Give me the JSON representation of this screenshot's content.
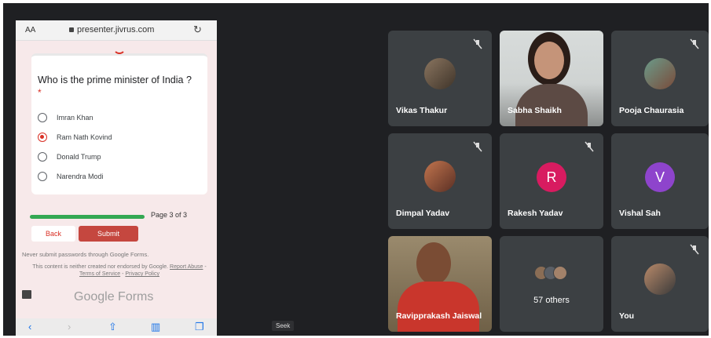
{
  "browser": {
    "text_size_label": "AA",
    "url": "presenter.jivrus.com"
  },
  "form": {
    "question": "Who is the prime minister of India ?",
    "required_mark": "*",
    "options": [
      {
        "label": "Imran Khan",
        "selected": false
      },
      {
        "label": "Ram Nath Kovind",
        "selected": true
      },
      {
        "label": "Donald Trump",
        "selected": false
      },
      {
        "label": "Narendra Modi",
        "selected": false
      }
    ],
    "progress": 1.0,
    "page_label": "Page 3 of 3",
    "back_label": "Back",
    "submit_label": "Submit",
    "password_note": "Never submit passwords through Google Forms.",
    "disclaimer_start": "This content is neither created nor endorsed by Google.",
    "report_abuse": "Report Abuse",
    "terms": "Terms of Service",
    "privacy": "Privacy Policy",
    "brand": "Google Forms"
  },
  "seek_label": "Seek",
  "participants": [
    {
      "name": "Vikas Thakur"
    },
    {
      "name": "Sabha Shaikh"
    },
    {
      "name": "Pooja Chaurasia"
    },
    {
      "name": "Dimpal Yadav"
    },
    {
      "name": "Rakesh Yadav",
      "initial": "R",
      "color": "#d81b60"
    },
    {
      "name": "Vishal Sah",
      "initial": "V",
      "color": "#8e44cc"
    },
    {
      "name": "Ravipprakash Jaiswal"
    },
    {
      "others_label": "57 others"
    },
    {
      "name": "You"
    }
  ],
  "colors": {
    "meet_bg": "#1f2023",
    "tile_bg": "#3c4043",
    "forms_accent": "#d93025",
    "progress": "#34a853"
  }
}
